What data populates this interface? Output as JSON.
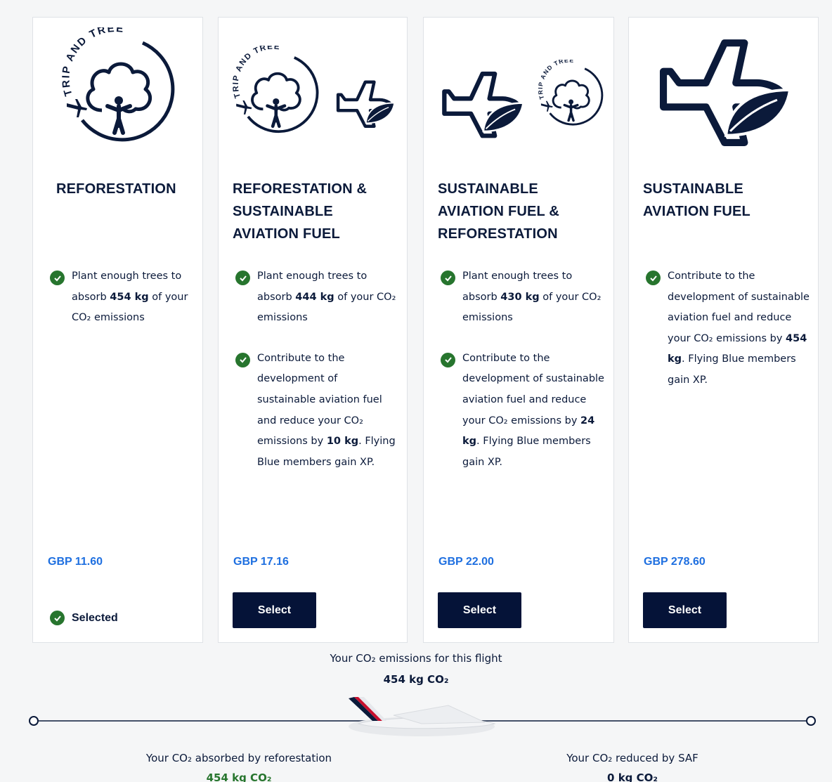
{
  "offers": [
    {
      "title": "REFORESTATION",
      "illustration": [
        "trip-and-tree-logo"
      ],
      "logo_text": "TRIP AND TREE",
      "benefits": [
        {
          "pre": "Plant enough trees to absorb ",
          "bold": "454 kg",
          "post": " of your CO₂ emissions",
          "extra": ""
        }
      ],
      "price": "GBP 11.60",
      "state": "Selected"
    },
    {
      "title": "REFORESTATION & SUSTAINABLE AVIATION FUEL",
      "illustration": [
        "trip-and-tree-logo",
        "plane-leaf-icon"
      ],
      "logo_text": "TRIP AND TREE",
      "benefits": [
        {
          "pre": "Plant enough trees to absorb ",
          "bold": "444 kg",
          "post": " of your CO₂ emissions",
          "extra": ""
        },
        {
          "pre": "Contribute to the development of sustainable aviation fuel and reduce your CO₂ emissions by ",
          "bold": "10 kg",
          "post": ".",
          "extra": "Flying Blue members gain XP."
        }
      ],
      "price": "GBP 17.16",
      "button_label": "Select"
    },
    {
      "title": "SUSTAINABLE AVIATION FUEL & REFORESTATION",
      "illustration": [
        "plane-leaf-icon",
        "trip-and-tree-logo"
      ],
      "logo_text": "TRIP AND TREE",
      "benefits": [
        {
          "pre": "Plant enough trees to absorb ",
          "bold": "430 kg",
          "post": " of your CO₂ emissions",
          "extra": ""
        },
        {
          "pre": "Contribute to the development of sustainable aviation fuel and reduce your CO₂ emissions by ",
          "bold": "24 kg",
          "post": ".",
          "extra": "Flying Blue members gain XP."
        }
      ],
      "price": "GBP 22.00",
      "button_label": "Select"
    },
    {
      "title": "SUSTAINABLE AVIATION FUEL",
      "illustration": [
        "plane-leaf-icon"
      ],
      "benefits": [
        {
          "pre": "Contribute to the development of sustainable aviation fuel and reduce your CO₂ emissions by ",
          "bold": "454 kg",
          "post": ".",
          "extra": "Flying Blue members gain XP."
        }
      ],
      "price": "GBP 278.60",
      "button_label": "Select"
    }
  ],
  "summary": {
    "label": "Your CO₂ emissions for this flight",
    "value": "454 kg CO₂",
    "absorbed_label": "Your CO₂ absorbed by reforestation",
    "absorbed_value": "454 kg CO₂",
    "reduced_label": "Your CO₂ reduced by SAF",
    "reduced_value": "0 kg CO₂",
    "slider_position_percent": 0
  },
  "colors": {
    "navy": "#051338",
    "text": "#0b1a3a",
    "price_blue": "#1e6fe0",
    "check_green": "#27752e",
    "absorbed_green": "#27752e"
  }
}
